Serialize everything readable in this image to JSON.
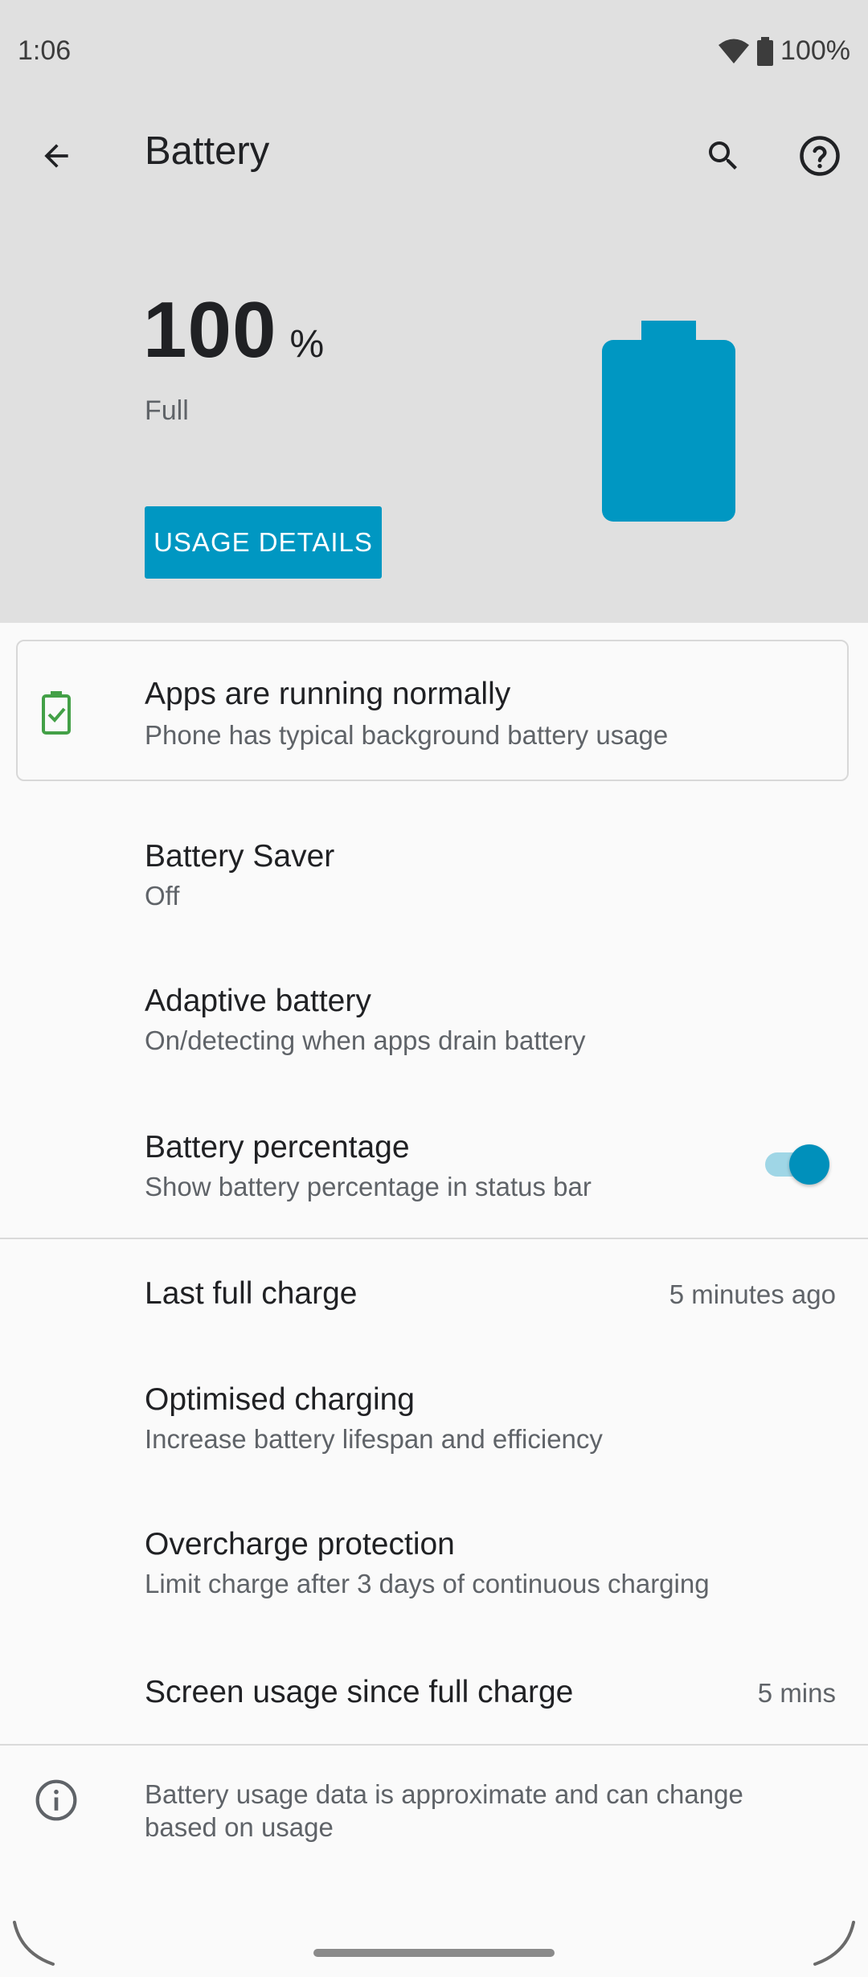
{
  "status_bar": {
    "time": "1:06",
    "battery_text": "100%"
  },
  "app_bar": {
    "title": "Battery",
    "back_icon": "arrow-back-icon",
    "search_icon": "search-icon",
    "help_icon": "help-icon"
  },
  "hero": {
    "level_value": "100",
    "level_unit": "%",
    "status": "Full",
    "usage_button_label": "USAGE DETAILS",
    "battery_fill_fraction": 1.0,
    "accent_color": "#0097c2"
  },
  "tip": {
    "title": "Apps are running normally",
    "subtitle": "Phone has typical background battery usage",
    "icon": "battery-check-icon",
    "icon_color": "#43a047"
  },
  "settings": {
    "battery_saver": {
      "title": "Battery Saver",
      "summary": "Off"
    },
    "adaptive_battery": {
      "title": "Adaptive battery",
      "summary": "On/detecting when apps drain battery"
    },
    "battery_percentage": {
      "title": "Battery percentage",
      "summary": "Show battery percentage in status bar",
      "enabled": true
    }
  },
  "info": {
    "last_full_charge": {
      "title": "Last full charge",
      "value": "5 minutes ago"
    },
    "optimised_charging": {
      "title": "Optimised charging",
      "summary": "Increase battery lifespan and efficiency"
    },
    "overcharge_protection": {
      "title": "Overcharge protection",
      "summary": "Limit charge after 3 days of continuous charging"
    },
    "screen_usage": {
      "title": "Screen usage since full charge",
      "value": "5 mins"
    }
  },
  "footer": {
    "text": "Battery usage data is approximate and can change based on usage",
    "icon": "info-icon"
  }
}
